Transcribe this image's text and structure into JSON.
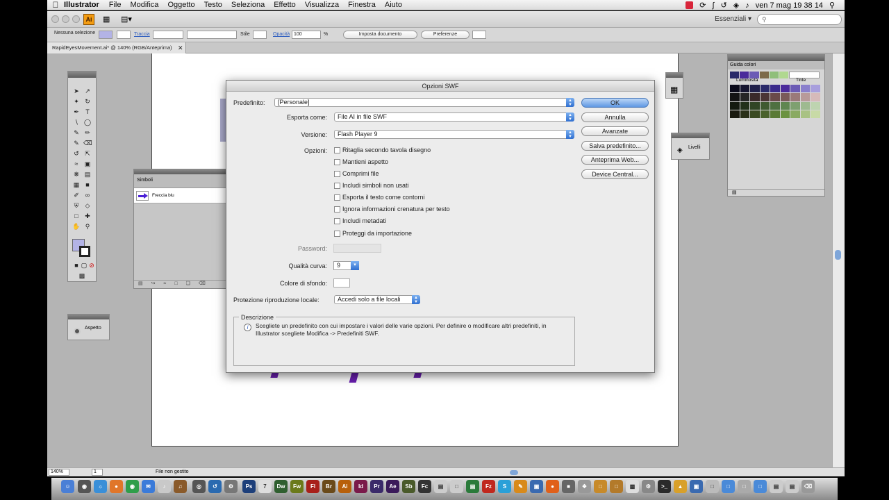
{
  "menubar": {
    "app": "Illustrator",
    "items": [
      "File",
      "Modifica",
      "Oggetto",
      "Testo",
      "Seleziona",
      "Effetto",
      "Visualizza",
      "Finestra",
      "Aiuto"
    ],
    "clock": "ven 7 mag  19 38 14"
  },
  "appbar": {
    "logo": "Ai",
    "workspace": "Essenziali ▾"
  },
  "control": {
    "selection": "Nessuna selezione",
    "stroke_label": "Traccia",
    "style_label": "Stile",
    "opacity_label": "Opacità",
    "opacity_value": "100",
    "percent": "%",
    "doc_button": "Imposta documento",
    "prefs_button": "Preferenze"
  },
  "doc_tab": {
    "title": "RapidEyesMovement.ai* @ 140% (RGB/Anteprima)",
    "close": "✕"
  },
  "panels": {
    "symbols_title": "Simboli",
    "symbol_item": "Freccia blu",
    "aspect": "Aspetto",
    "layers": "Livelli",
    "color_guide_title": "Guida colori",
    "luminosity": "Luminosità",
    "tints": "Tinte"
  },
  "status": {
    "zoom": "140%",
    "page": "1",
    "state": "File non gestito"
  },
  "dialog": {
    "title": "Opzioni SWF",
    "preset_label": "Predefinito:",
    "preset_value": "[Personale]",
    "export_label": "Esporta come:",
    "export_value": "File AI in file SWF",
    "version_label": "Versione:",
    "version_value": "Flash Player 9",
    "options_label": "Opzioni:",
    "options": [
      "Ritaglia secondo tavola disegno",
      "Mantieni aspetto",
      "Comprimi file",
      "Includi simboli non usati",
      "Esporta il testo come contorni",
      "Ignora informazioni crenatura per testo",
      "Includi metadati",
      "Proteggi da importazione"
    ],
    "password_label": "Password:",
    "quality_label": "Qualità curva:",
    "quality_value": "9",
    "bg_label": "Colore di sfondo:",
    "protection_label": "Protezione riproduzione locale:",
    "protection_value": "Accedi solo a file locali",
    "buttons": [
      "OK",
      "Annulla",
      "Avanzate",
      "Salva predefinito...",
      "Anteprima Web...",
      "Device Central..."
    ],
    "desc_title": "Descrizione",
    "desc_text": "Scegliete un predefinito con cui impostare i valori delle varie opzioni. Per definire o modificare altri predefiniti, in Illustrator scegliete Modifica -> Predefiniti SWF."
  },
  "dock": [
    "Ps",
    "Dw",
    "Fw",
    "Fl",
    "Br",
    "Ai",
    "Id",
    "Pr",
    "Ae",
    "Sb",
    "Fc"
  ],
  "colors": {
    "accent": "#3b7bd9",
    "ai_logo": "#f39c12",
    "symbol_arrow": "#4b21d6",
    "art_purple": "#6a1fb0"
  }
}
